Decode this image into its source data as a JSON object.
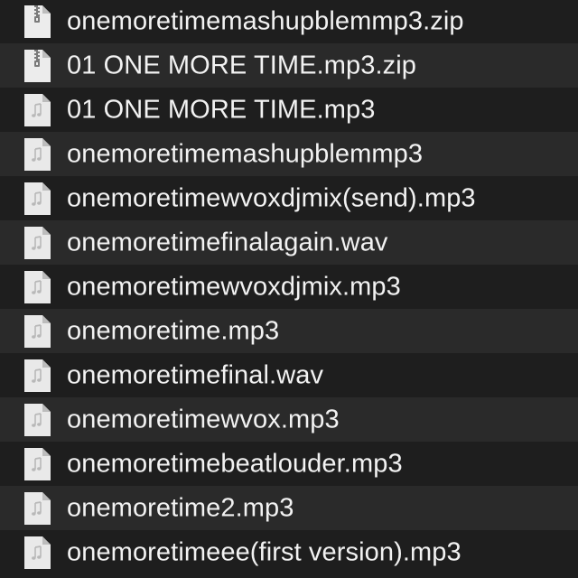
{
  "colors": {
    "background": "#1e1e1e",
    "row_alt": "#2a2a2a",
    "text": "#f2f2f2",
    "icon_paper": "#e9e9e9"
  },
  "files": [
    {
      "name": "onemoretimemashupblemmp3.zip",
      "icon": "zip-icon"
    },
    {
      "name": "01 ONE MORE TIME.mp3.zip",
      "icon": "zip-icon"
    },
    {
      "name": "01 ONE MORE TIME.mp3",
      "icon": "audio-file-icon"
    },
    {
      "name": "onemoretimemashupblemmp3",
      "icon": "audio-file-icon"
    },
    {
      "name": "onemoretimewvoxdjmix(send).mp3",
      "icon": "audio-file-icon"
    },
    {
      "name": "onemoretimefinalagain.wav",
      "icon": "audio-file-icon"
    },
    {
      "name": "onemoretimewvoxdjmix.mp3",
      "icon": "audio-file-icon"
    },
    {
      "name": "onemoretime.mp3",
      "icon": "audio-file-icon"
    },
    {
      "name": "onemoretimefinal.wav",
      "icon": "audio-file-icon"
    },
    {
      "name": "onemoretimewvox.mp3",
      "icon": "audio-file-icon"
    },
    {
      "name": "onemoretimebeatlouder.mp3",
      "icon": "audio-file-icon"
    },
    {
      "name": "onemoretime2.mp3",
      "icon": "audio-file-icon"
    },
    {
      "name": "onemoretimeee(first version).mp3",
      "icon": "audio-file-icon"
    }
  ]
}
